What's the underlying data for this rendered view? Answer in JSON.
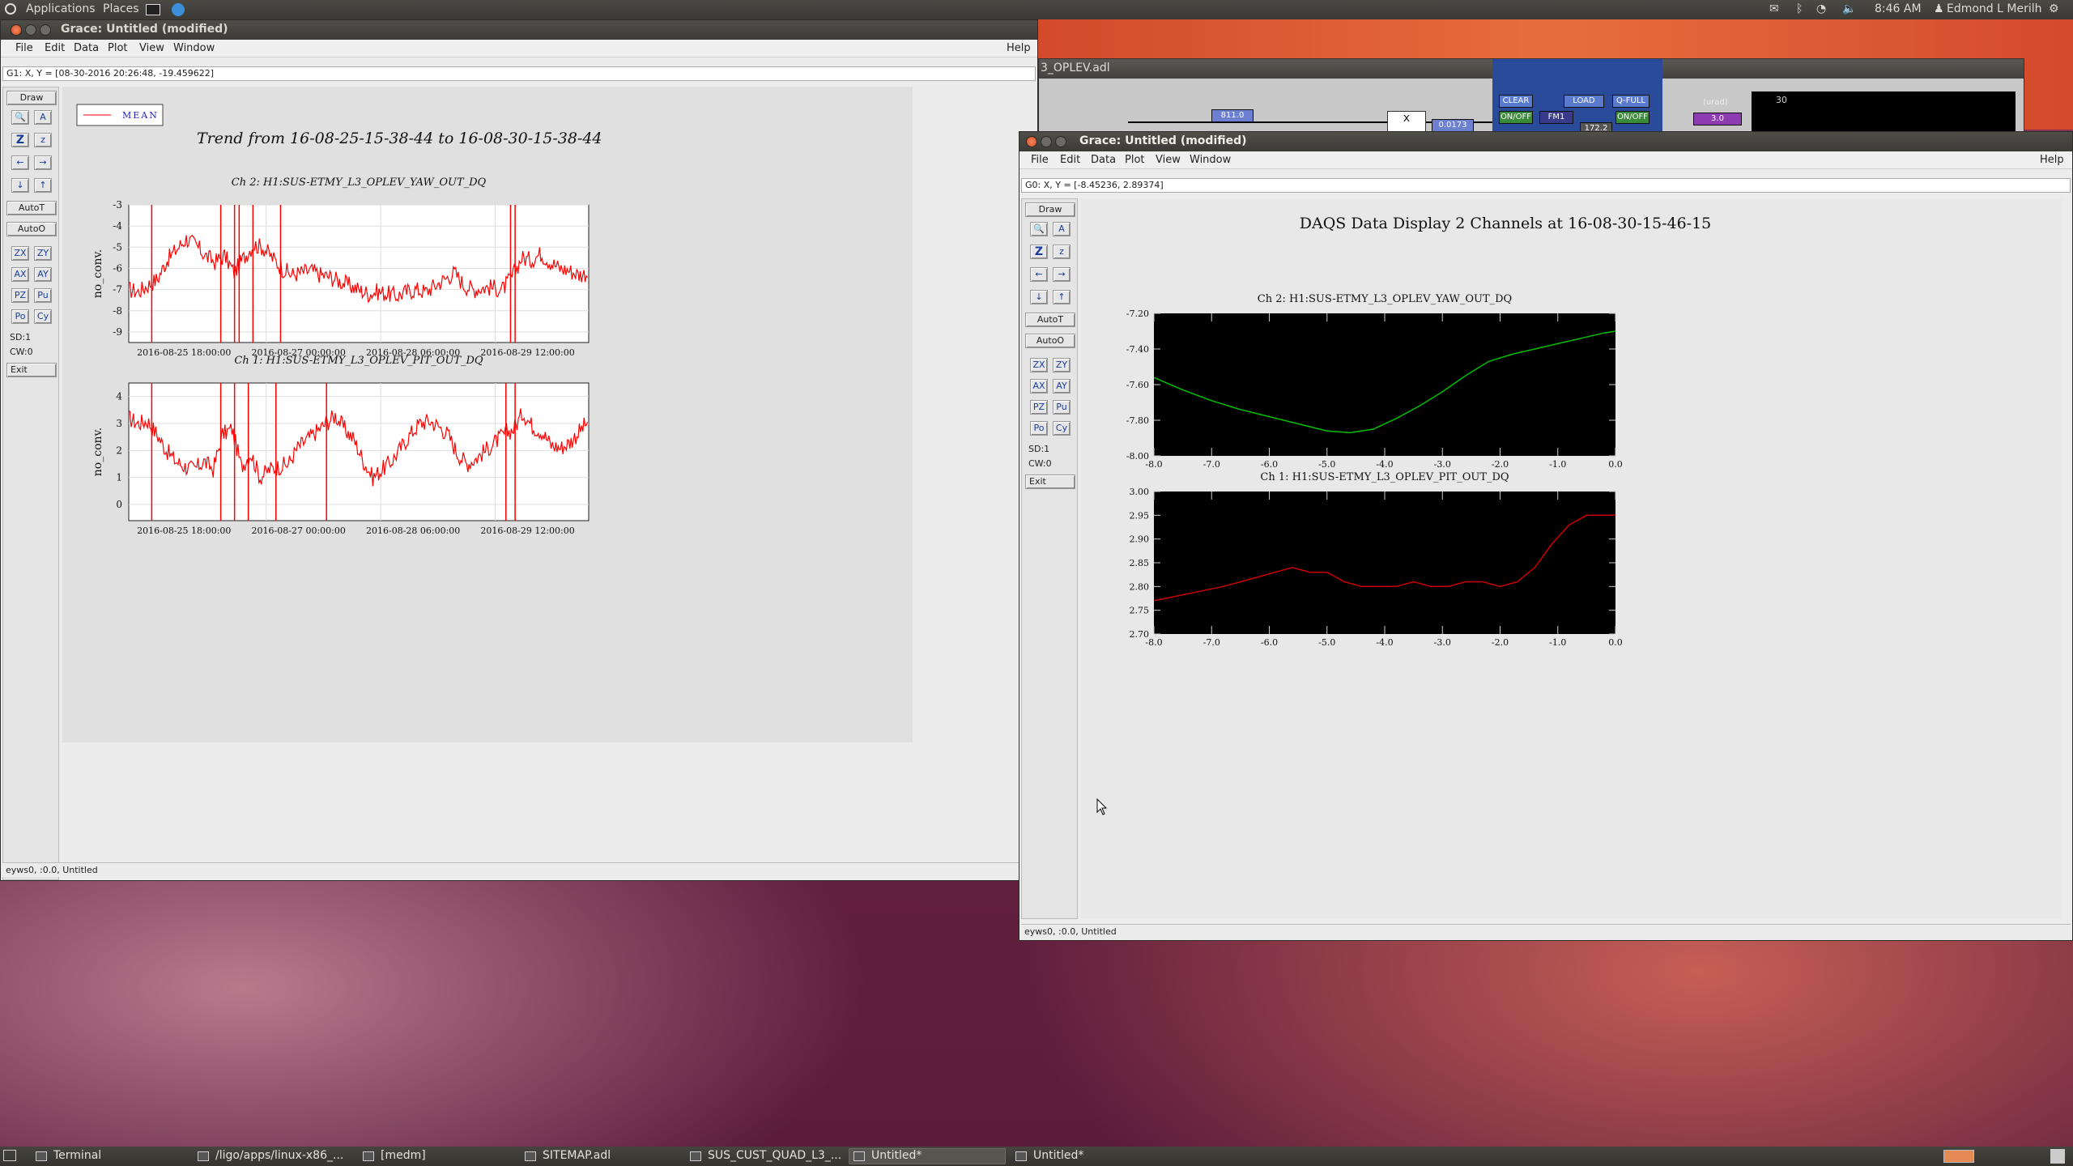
{
  "panel": {
    "applications": "Applications",
    "places": "Places",
    "clock": "8:46 AM",
    "user": "Edmond L Merilh"
  },
  "win1": {
    "title": "Grace: Untitled (modified)",
    "menus": [
      "File",
      "Edit",
      "Data",
      "Plot",
      "View",
      "Window"
    ],
    "help": "Help",
    "locator": "G1: X, Y = [08-30-2016 20:26:48, -19.459622]",
    "status": "eyws0, :0.0, Untitled",
    "tools": {
      "draw": "Draw",
      "autot": "AutoT",
      "autoo": "AutoO",
      "zx": "ZX",
      "zy": "ZY",
      "ax": "AX",
      "ay": "AY",
      "pz": "PZ",
      "pu": "Pu",
      "po": "Po",
      "cy": "Cy",
      "sd": "SD:1",
      "cw": "CW:0",
      "exit": "Exit"
    },
    "legend": "MEAN",
    "trend_title": "Trend from 16-08-25-15-38-44 to 16-08-30-15-38-44"
  },
  "win2": {
    "title": "Grace: Untitled (modified)",
    "menus": [
      "File",
      "Edit",
      "Data",
      "Plot",
      "View",
      "Window"
    ],
    "help": "Help",
    "locator": "G0: X, Y = [-8.45236, 2.89374]",
    "status": "eyws0, :0.0, Untitled",
    "tools": {
      "draw": "Draw",
      "autot": "AutoT",
      "autoo": "AutoO",
      "zx": "ZX",
      "zy": "ZY",
      "ax": "AX",
      "ay": "AY",
      "pz": "PZ",
      "pu": "Pu",
      "po": "Po",
      "cy": "Cy",
      "sd": "SD:1",
      "cw": "CW:0",
      "exit": "Exit"
    },
    "display_title": "DAQS Data Display 2 Channels at 16-08-30-15-46-15"
  },
  "medm": {
    "title": "3_OPLEV.adl",
    "value1": "811.0",
    "value2": "0.0173",
    "clear": "CLEAR",
    "load": "LOAD",
    "qfull": "Q-FULL",
    "onoff1": "ON/OFF",
    "fm1": "FM1",
    "onoff2": "ON/OFF",
    "urad": "(urad)",
    "value3": "3.0",
    "num": "30",
    "val4": "172.2",
    "mult": "x"
  },
  "taskbar": [
    "Terminal",
    "/ligo/apps/linux-x86_...",
    "[medm]",
    "SITEMAP.adl",
    "SUS_CUST_QUAD_L3_...",
    "Untitled*",
    "Untitled*"
  ],
  "colors": {
    "red": "#ff0000",
    "green": "#00c000",
    "darkred": "#cc0000"
  },
  "chart_data": [
    {
      "type": "line",
      "title": "Ch 2: H1:SUS-ETMY_L3_OPLEV_YAW_OUT_DQ",
      "xlabel": "",
      "ylabel": "no_conv.",
      "ylim": [
        -9.5,
        -3
      ],
      "yticks": [
        -3,
        -4,
        -5,
        -6,
        -7,
        -8,
        -9
      ],
      "xticks": [
        "2016-08-25 18:00:00",
        "2016-08-27 00:00:00",
        "2016-08-28 06:00:00",
        "2016-08-29 12:00:00"
      ],
      "xtick_pos": [
        0.05,
        0.3,
        0.55,
        0.8
      ],
      "series": [
        {
          "name": "MEAN",
          "color": "#ff0000",
          "values": [
            -7,
            -7.1,
            -6.8,
            -6.5,
            -5.6,
            -5.1,
            -4.6,
            -4.9,
            -5.4,
            -5.7,
            -5.4,
            -6.2,
            -5.5,
            -4.9,
            -5.0,
            -5.5,
            -6.0,
            -6.3,
            -6.2,
            -6.1,
            -6.3,
            -6.4,
            -6.6,
            -6.8,
            -7.0,
            -7.2,
            -7.1,
            -7.2,
            -7.3,
            -7.1,
            -7.0,
            -7.1,
            -6.8,
            -6.5,
            -6.2,
            -6.8,
            -7.0,
            -6.9,
            -6.9,
            -7.0,
            -6.4,
            -5.5,
            -5.6,
            -5.3,
            -5.7,
            -6.0,
            -6.1,
            -6.3,
            -6.2
          ]
        }
      ],
      "spikes": [
        0.05,
        0.2,
        0.23,
        0.24,
        0.27,
        0.33,
        0.83,
        0.84
      ]
    },
    {
      "type": "line",
      "title": "Ch 1: H1:SUS-ETMY_L3_OPLEV_PIT_OUT_DQ",
      "xlabel": "",
      "ylabel": "no_conv.",
      "ylim": [
        -0.6,
        4.5
      ],
      "yticks": [
        4,
        3,
        2,
        1,
        0
      ],
      "xticks": [
        "2016-08-25 18:00:00",
        "2016-08-27 00:00:00",
        "2016-08-28 06:00:00",
        "2016-08-29 12:00:00"
      ],
      "xtick_pos": [
        0.05,
        0.3,
        0.55,
        0.8
      ],
      "series": [
        {
          "name": "MEAN",
          "color": "#ff0000",
          "values": [
            3.2,
            3.0,
            3.1,
            2.6,
            2.0,
            1.6,
            1.4,
            1.3,
            1.6,
            1.3,
            2.6,
            2.8,
            1.4,
            1.9,
            1.0,
            1.3,
            1.4,
            1.5,
            2.1,
            2.4,
            2.7,
            3.0,
            3.3,
            2.8,
            2.4,
            1.6,
            1.0,
            1.3,
            1.6,
            2.1,
            2.6,
            3.0,
            3.1,
            2.9,
            2.6,
            1.9,
            1.5,
            1.7,
            2.0,
            2.3,
            2.6,
            2.8,
            3.4,
            2.9,
            2.7,
            2.2,
            2.1,
            2.3,
            2.7,
            3.1
          ]
        }
      ],
      "spikes": [
        0.05,
        0.2,
        0.23,
        0.26,
        0.32,
        0.43,
        0.82,
        0.84
      ]
    },
    {
      "type": "line",
      "title": "Ch 2:  H1:SUS-ETMY_L3_OPLEV_YAW_OUT_DQ",
      "ylim": [
        -8.0,
        -7.2
      ],
      "yticks": [
        -7.2,
        -7.4,
        -7.6,
        -7.8,
        -8.0
      ],
      "xlim": [
        -8.0,
        0.0
      ],
      "xticks": [
        -8.0,
        -7.0,
        -6.0,
        -5.0,
        -4.0,
        -3.0,
        -2.0,
        -1.0,
        0.0
      ],
      "series": [
        {
          "name": "",
          "color": "#00c000",
          "x": [
            -8.0,
            -7.5,
            -7.0,
            -6.5,
            -6.0,
            -5.5,
            -5.0,
            -4.6,
            -4.2,
            -3.8,
            -3.4,
            -3.0,
            -2.6,
            -2.2,
            -1.8,
            -1.4,
            -1.0,
            -0.6,
            -0.2,
            0.0
          ],
          "y": [
            -7.56,
            -7.63,
            -7.69,
            -7.74,
            -7.78,
            -7.82,
            -7.86,
            -7.87,
            -7.85,
            -7.79,
            -7.72,
            -7.64,
            -7.55,
            -7.47,
            -7.43,
            -7.4,
            -7.37,
            -7.34,
            -7.31,
            -7.3
          ]
        }
      ]
    },
    {
      "type": "line",
      "title": "Ch 1:  H1:SUS-ETMY_L3_OPLEV_PIT_OUT_DQ",
      "ylim": [
        2.7,
        3.0
      ],
      "yticks": [
        3.0,
        2.95,
        2.9,
        2.85,
        2.8,
        2.75,
        2.7
      ],
      "xlim": [
        -8.0,
        0.0
      ],
      "xticks": [
        -8.0,
        -7.0,
        -6.0,
        -5.0,
        -4.0,
        -3.0,
        -2.0,
        -1.0,
        0.0
      ],
      "series": [
        {
          "name": "",
          "color": "#cc0000",
          "x": [
            -8.0,
            -7.6,
            -7.2,
            -6.8,
            -6.5,
            -6.2,
            -5.9,
            -5.6,
            -5.3,
            -5.0,
            -4.7,
            -4.4,
            -4.1,
            -3.8,
            -3.5,
            -3.2,
            -2.9,
            -2.6,
            -2.3,
            -2.0,
            -1.7,
            -1.4,
            -1.1,
            -0.8,
            -0.5,
            -0.2,
            0.0
          ],
          "y": [
            2.77,
            2.78,
            2.79,
            2.8,
            2.81,
            2.82,
            2.83,
            2.84,
            2.83,
            2.83,
            2.81,
            2.8,
            2.8,
            2.8,
            2.81,
            2.8,
            2.8,
            2.81,
            2.81,
            2.8,
            2.81,
            2.84,
            2.89,
            2.93,
            2.95,
            2.95,
            2.95
          ]
        }
      ]
    }
  ]
}
